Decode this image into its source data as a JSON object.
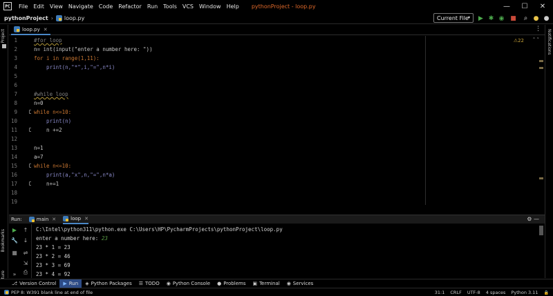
{
  "menubar": {
    "logo_text": "PC",
    "items": [
      "File",
      "Edit",
      "View",
      "Navigate",
      "Code",
      "Refactor",
      "Run",
      "Tools",
      "VCS",
      "Window",
      "Help"
    ],
    "window_title": "pythonProject - loop.py",
    "minimize": "—",
    "maximize": "☐",
    "close": "✕"
  },
  "navbar": {
    "project": "pythonProject",
    "separator": "›",
    "file": "loop.py",
    "run_config": "Current File",
    "run_config_caret": "▾",
    "icons": {
      "run": "▶",
      "debug": "✱",
      "coverage": "◉",
      "stop": "■",
      "search": "⌕",
      "updates": "●",
      "settings": "●"
    }
  },
  "left_strip": {
    "project_label": "Project",
    "bookmarks_label": "Bookmarks",
    "structure_label": "Structure"
  },
  "right_strip": {
    "notifications_label": "Notifications"
  },
  "editor": {
    "tab_label": "loop.py",
    "tab_close": "✕",
    "tab_menu": "⋮",
    "inspection_count": "⚠22",
    "inspection_nav": "˄ ˅",
    "line_numbers": [
      "1",
      "2",
      "3",
      "4",
      "5",
      "6",
      "7",
      "8",
      "9",
      "10",
      "11",
      "12",
      "13",
      "14",
      "15",
      "16",
      "17",
      "18",
      "19"
    ],
    "lines": [
      "#for loop",
      "n= int(input(\"enter a number here: \"))",
      "for i in range(1,11):",
      "    print(n,\"*\",i,\"=\",n*i)",
      "",
      "",
      "#while loop",
      "n=0",
      "while n<=10:",
      "    print(n)",
      "    n +=2",
      "",
      "n=1",
      "a=7",
      "while n<=10:",
      "    print(a,\"x\",n,\"=\",n*a)",
      "    n+=1",
      "",
      ""
    ]
  },
  "run_panel": {
    "label": "Run:",
    "tabs": [
      {
        "label": "main",
        "close": "✕"
      },
      {
        "label": "loop",
        "close": "✕"
      }
    ],
    "actions": "⚙ —",
    "console_lines": [
      "C:\\Intel\\python311\\python.exe C:\\Users\\HP\\PycharmProjects\\pythonProject\\loop.py",
      "enter a number here: ",
      "23 * 1 = 23",
      "23 * 2 = 46",
      "23 * 3 = 69",
      "23 * 4 = 92"
    ],
    "user_input": "23",
    "toolbar_icons": [
      "▶",
      "↑",
      "🔧",
      "↓",
      "■",
      "⇌",
      "⇲",
      "⎙",
      "»",
      "🗑"
    ]
  },
  "tool_tabs": [
    {
      "label": "Version Control",
      "icon": "⎇",
      "active": false
    },
    {
      "label": "Run",
      "icon": "▶",
      "active": true
    },
    {
      "label": "Python Packages",
      "icon": "◈",
      "active": false
    },
    {
      "label": "TODO",
      "icon": "☰",
      "active": false
    },
    {
      "label": "Python Console",
      "icon": "◉",
      "active": false
    },
    {
      "label": "Problems",
      "icon": "●",
      "active": false
    },
    {
      "label": "Terminal",
      "icon": "▣",
      "active": false
    },
    {
      "label": "Services",
      "icon": "◉",
      "active": false
    }
  ],
  "statusbar": {
    "message": "PEP 8: W391 blank line at end of file",
    "position": "31:1",
    "line_sep": "CRLF",
    "encoding": "UTF-8",
    "indent": "4 spaces",
    "interpreter": "Python 3.11",
    "lock_icon": "🔒"
  },
  "colors": {
    "accent": "#e0692a",
    "active_tab": "#2d4b86",
    "keyword": "#cc7832",
    "string": "#6a8759",
    "number": "#6897bb",
    "comment": "#808080"
  }
}
